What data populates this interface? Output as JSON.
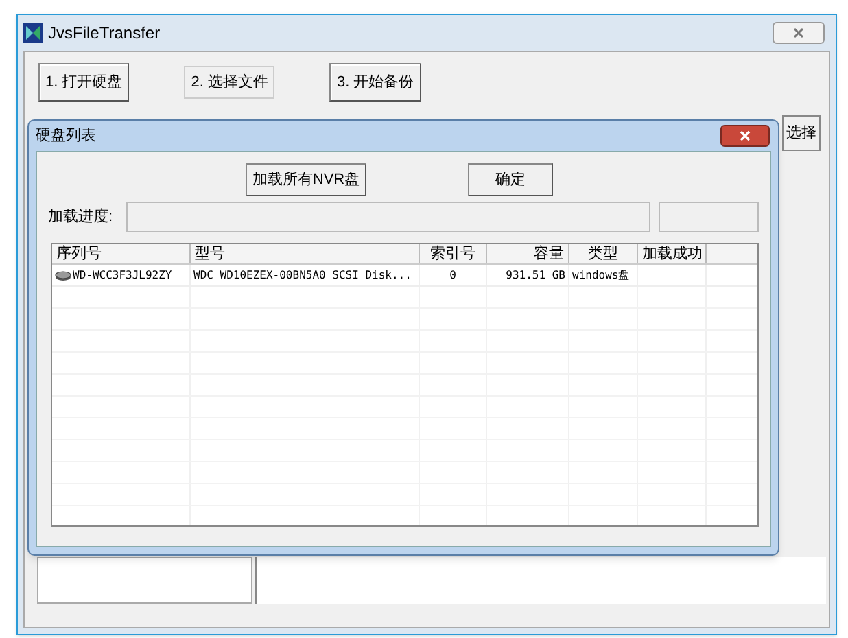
{
  "window": {
    "title": "JvsFileTransfer"
  },
  "steps": [
    {
      "label": "1. 打开硬盘",
      "selected": false
    },
    {
      "label": "2. 选择文件",
      "selected": true
    },
    {
      "label": "3. 开始备份",
      "selected": false
    }
  ],
  "side_button": "选择",
  "dialog": {
    "title": "硬盘列表",
    "buttons": [
      "加载所有NVR盘",
      "确定"
    ],
    "progress_label": "加载进度:",
    "table": {
      "columns": [
        "序列号",
        "型号",
        "索引号",
        "容量",
        "类型",
        "加载成功"
      ],
      "rows": [
        [
          "WD-WCC3F3JL92ZY",
          "WDC WD10EZEX-00BN5A0 SCSI Disk...",
          "0",
          "931.51 GB",
          "windows盘",
          ""
        ]
      ]
    }
  }
}
